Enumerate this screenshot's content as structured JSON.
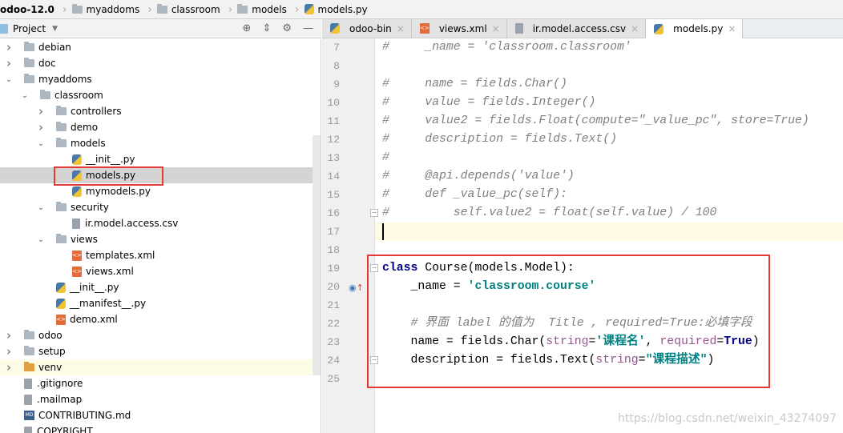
{
  "breadcrumb": [
    "odoo-12.0",
    "myaddoms",
    "classroom",
    "models",
    "models.py"
  ],
  "project_panel": {
    "title": "Project",
    "tools": [
      "crosshair-icon",
      "collapse-icon",
      "gear-icon",
      "minimize-icon"
    ]
  },
  "tree": [
    {
      "label": "debian",
      "type": "folder",
      "level": 0,
      "expand": "closed"
    },
    {
      "label": "doc",
      "type": "folder",
      "level": 0,
      "expand": "closed"
    },
    {
      "label": "myaddoms",
      "type": "folder",
      "level": 0,
      "expand": "open"
    },
    {
      "label": "classroom",
      "type": "folder",
      "level": 1,
      "expand": "open"
    },
    {
      "label": "controllers",
      "type": "folder",
      "level": 2,
      "expand": "closed"
    },
    {
      "label": "demo",
      "type": "folder",
      "level": 2,
      "expand": "closed"
    },
    {
      "label": "models",
      "type": "folder",
      "level": 2,
      "expand": "open"
    },
    {
      "label": "__init__.py",
      "type": "py",
      "level": 3
    },
    {
      "label": "models.py",
      "type": "py",
      "level": 3,
      "selected": true
    },
    {
      "label": "mymodels.py",
      "type": "py",
      "level": 3
    },
    {
      "label": "security",
      "type": "folder",
      "level": 2,
      "expand": "open"
    },
    {
      "label": "ir.model.access.csv",
      "type": "txt",
      "level": 3
    },
    {
      "label": "views",
      "type": "folder",
      "level": 2,
      "expand": "open"
    },
    {
      "label": "templates.xml",
      "type": "xml",
      "level": 3
    },
    {
      "label": "views.xml",
      "type": "xml",
      "level": 3
    },
    {
      "label": "__init__.py",
      "type": "py",
      "level": 2
    },
    {
      "label": "__manifest__.py",
      "type": "py",
      "level": 2
    },
    {
      "label": "demo.xml",
      "type": "xml",
      "level": 2
    },
    {
      "label": "odoo",
      "type": "folder",
      "level": 0,
      "expand": "closed"
    },
    {
      "label": "setup",
      "type": "folder",
      "level": 0,
      "expand": "closed"
    },
    {
      "label": "venv",
      "type": "folder-orange",
      "level": 0,
      "expand": "closed",
      "highlight": true
    },
    {
      "label": ".gitignore",
      "type": "txt",
      "level": 0
    },
    {
      "label": ".mailmap",
      "type": "txt",
      "level": 0
    },
    {
      "label": "CONTRIBUTING.md",
      "type": "md",
      "level": 0
    },
    {
      "label": "COPYRIGHT",
      "type": "txt",
      "level": 0
    }
  ],
  "tabs": [
    {
      "label": "odoo-bin",
      "icon": "py",
      "active": false
    },
    {
      "label": "views.xml",
      "icon": "xml",
      "active": false
    },
    {
      "label": "ir.model.access.csv",
      "icon": "txt",
      "active": false
    },
    {
      "label": "models.py",
      "icon": "py",
      "active": true
    }
  ],
  "code": [
    {
      "n": "7",
      "html": "<span class='cm'>#     _name = 'classroom.classroom'</span>"
    },
    {
      "n": "8",
      "html": ""
    },
    {
      "n": "9",
      "html": "<span class='cm'>#     name = fields.Char()</span>"
    },
    {
      "n": "10",
      "html": "<span class='cm'>#     value = fields.Integer()</span>"
    },
    {
      "n": "11",
      "html": "<span class='cm'>#     value2 = fields.Float(compute=\"_value_pc\", store=True)</span>"
    },
    {
      "n": "12",
      "html": "<span class='cm'>#     description = fields.Text()</span>"
    },
    {
      "n": "13",
      "html": "<span class='cm'>#</span>"
    },
    {
      "n": "14",
      "html": "<span class='cm'>#     @api.depends('value')</span>"
    },
    {
      "n": "15",
      "html": "<span class='cm'>#     def _value_pc(self):</span>"
    },
    {
      "n": "16",
      "html": "<span class='cm'>#         self.value2 = float(self.value) / 100</span>"
    },
    {
      "n": "17",
      "html": ""
    },
    {
      "n": "18",
      "html": ""
    },
    {
      "n": "19",
      "html": "<span class='kw'>class</span> Course(models.Model):"
    },
    {
      "n": "20",
      "html": "    _name = <span class='st'>'classroom.course'</span>"
    },
    {
      "n": "21",
      "html": ""
    },
    {
      "n": "22",
      "html": "    <span class='cm'># 界面 label 的值为  Title , required=True:必填字段</span>"
    },
    {
      "n": "23",
      "html": "    name = fields.Char(<span class='pa'>string</span>=<span class='st'>'课程名'</span>, <span class='pa'>required</span>=<span class='kw'>True</span>)"
    },
    {
      "n": "24",
      "html": "    description = fields.Text(<span class='pa'>string</span>=<span class='st'>\"课程描述\"</span>)"
    },
    {
      "n": "25",
      "html": ""
    }
  ],
  "current_line": "17",
  "watermark": "https://blog.csdn.net/weixin_43274097",
  "colors": {
    "highlight_box": "#e53935",
    "selection": "#d4d4d4",
    "current_line": "#fffae3"
  }
}
